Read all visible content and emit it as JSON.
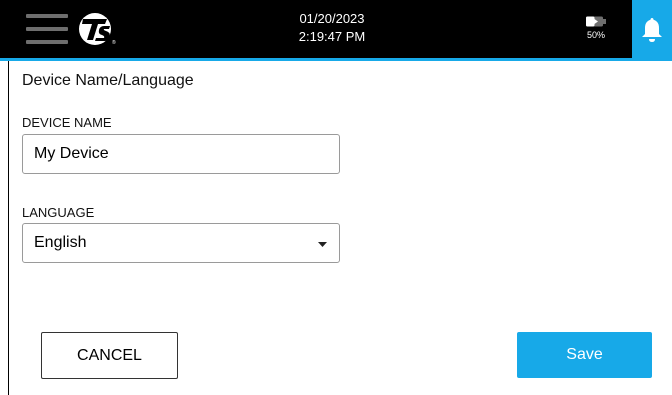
{
  "header": {
    "date": "01/20/2023",
    "time": "2:19:47 PM",
    "battery_percent": "50%",
    "battery_level": 0.5,
    "menu_icon": "hamburger-menu-icon",
    "logo_icon": "tsi-logo",
    "battery_icon": "battery-icon",
    "notification_icon": "bell-icon"
  },
  "page": {
    "title": "Device Name/Language"
  },
  "form": {
    "device_name": {
      "label": "DEVICE NAME",
      "value": "My Device"
    },
    "language": {
      "label": "LANGUAGE",
      "selected": "English"
    }
  },
  "actions": {
    "cancel_label": "CANCEL",
    "save_label": "Save"
  },
  "colors": {
    "accent": "#17a9e8",
    "header_bg": "#000000"
  }
}
